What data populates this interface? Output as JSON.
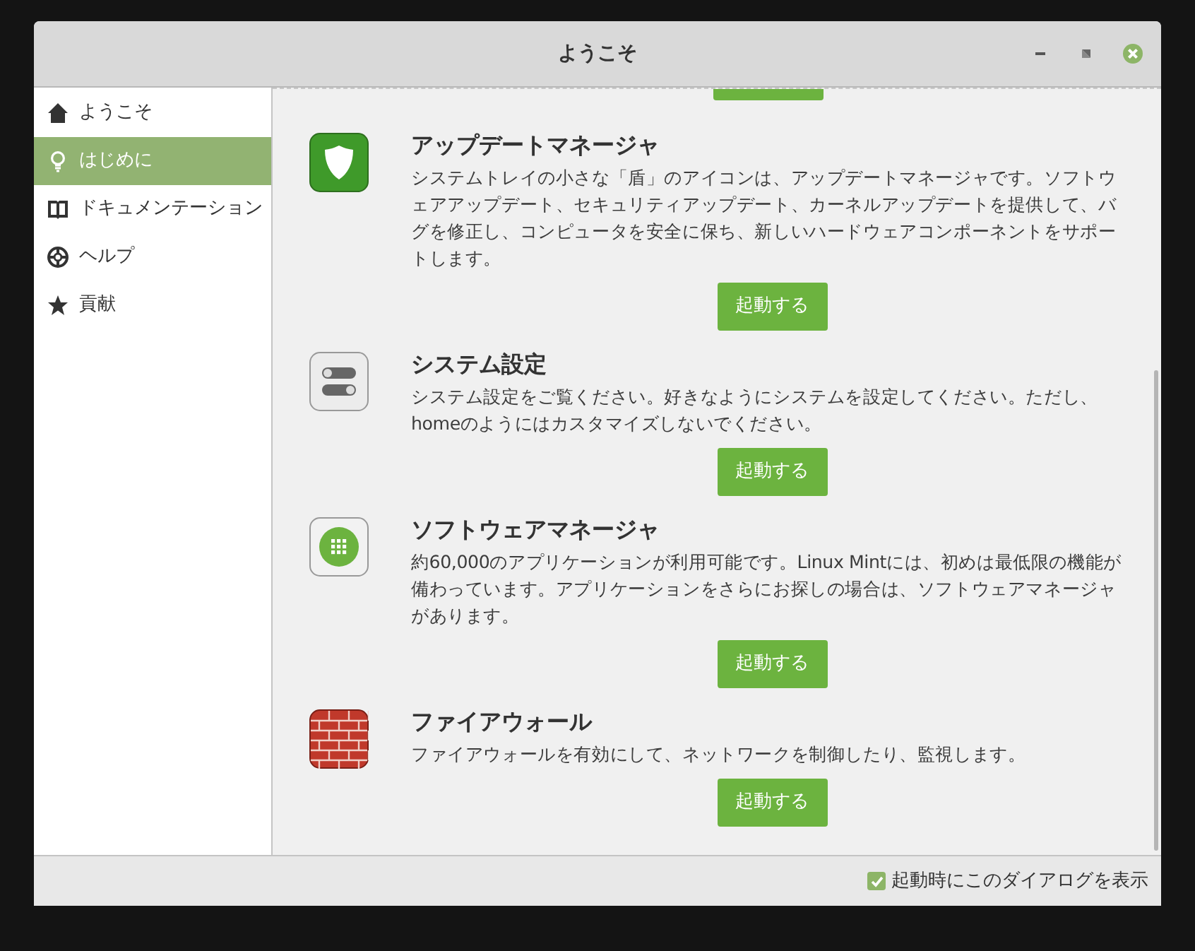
{
  "window": {
    "title": "ようこそ"
  },
  "sidebar": {
    "items": [
      {
        "label": "ようこそ",
        "kind": "home",
        "selected": false
      },
      {
        "label": "はじめに",
        "kind": "bulb",
        "selected": true
      },
      {
        "label": "ドキュメンテーション",
        "kind": "book",
        "selected": false
      },
      {
        "label": "ヘルプ",
        "kind": "help",
        "selected": false
      },
      {
        "label": "貢献",
        "kind": "star",
        "selected": false
      }
    ]
  },
  "sections": [
    {
      "kind": "shield",
      "title": "アップデートマネージャ",
      "text": "システムトレイの小さな「盾」のアイコンは、アップデートマネージャです。ソフトウェアアップデート、セキュリティアップデート、カーネルアップデートを提供して、バグを修正し、コンピュータを安全に保ち、新しいハードウェアコンポーネントをサポートします。",
      "button": "起動する"
    },
    {
      "kind": "toggles",
      "title": "システム設定",
      "text": "システム設定をご覧ください。好きなようにシステムを設定してください。ただし、homeのようにはカスタマイズしないでください。",
      "button": "起動する"
    },
    {
      "kind": "grid",
      "title": "ソフトウェアマネージャ",
      "text": "約60,000のアプリケーションが利用可能です。Linux Mintには、初めは最低限の機能が備わっています。アプリケーションをさらにお探しの場合は、ソフトウェアマネージャがあります。",
      "button": "起動する"
    },
    {
      "kind": "bricks",
      "title": "ファイアウォール",
      "text": "ファイアウォールを有効にして、ネットワークを制御したり、監視します。",
      "button": "起動する"
    }
  ],
  "footer": {
    "checkbox": {
      "label": "起動時にこのダイアログを表示",
      "checked": true
    }
  }
}
